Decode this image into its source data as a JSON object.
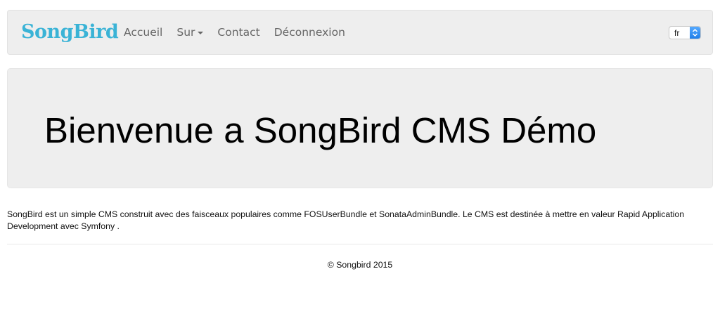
{
  "navbar": {
    "brand": "SongBird",
    "items": [
      {
        "label": "Accueil"
      },
      {
        "label": "Sur"
      },
      {
        "label": "Contact"
      },
      {
        "label": "Déconnexion"
      }
    ],
    "language": {
      "selected": "fr"
    }
  },
  "hero": {
    "title": "Bienvenue a SongBird CMS Démo"
  },
  "intro": {
    "text": "SongBird est un simple CMS construit avec des faisceaux populaires comme FOSUserBundle et SonataAdminBundle. Le CMS est destinée à mettre en valeur Rapid Application Development avec Symfony ."
  },
  "footer": {
    "copyright": "© Songbird 2015"
  },
  "colors": {
    "brand": "#3ab3d6",
    "navbar_bg": "#eeeeee",
    "nav_text": "#666666"
  },
  "icons": {
    "dropdown": "caret-down-icon",
    "select_arrows": "select-arrows-icon"
  }
}
